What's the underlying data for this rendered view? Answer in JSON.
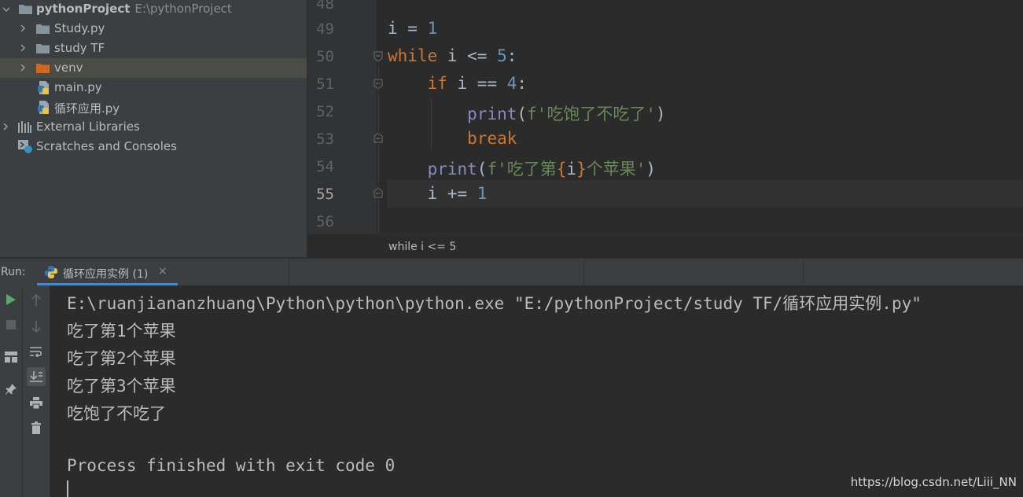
{
  "project": {
    "root_name": "pythonProject",
    "root_path": "E:\\pythonProject",
    "items": [
      {
        "label": "Study.py",
        "type": "folder"
      },
      {
        "label": "study TF",
        "type": "folder"
      },
      {
        "label": "venv",
        "type": "folder-excluded"
      },
      {
        "label": "main.py",
        "type": "python-file"
      },
      {
        "label": "循环应用.py",
        "type": "python-file"
      }
    ],
    "external_libraries": "External Libraries",
    "scratches": "Scratches and Consoles"
  },
  "editor": {
    "line_numbers": [
      "48",
      "49",
      "50",
      "51",
      "52",
      "53",
      "54",
      "55",
      "56"
    ],
    "current_line": "55",
    "code": {
      "l49": {
        "var": "i",
        "op": " = ",
        "num": "1"
      },
      "l50": {
        "kw": "while",
        "mid": " i <= ",
        "num": "5",
        "end": ":"
      },
      "l51": {
        "kw": "if",
        "mid": " i == ",
        "num": "4",
        "end": ":"
      },
      "l52": {
        "fn": "print",
        "open": "(",
        "str": "f'吃饱了不吃了'",
        "close": ")"
      },
      "l53": {
        "kw": "break"
      },
      "l54": {
        "fn": "print",
        "open": "(",
        "str1": "f'吃了第",
        "br1": "{",
        "var": "i",
        "br2": "}",
        "str2": "个苹果'",
        "close": ")"
      },
      "l55": {
        "mid": "i += ",
        "num": "1"
      }
    },
    "breadcrumb": "while i <= 5"
  },
  "run": {
    "label": "Run:",
    "tab_title": "循环应用实例 (1)",
    "tab_close": "×",
    "console_lines": [
      "E:\\ruanjiananzhuang\\Python\\python\\python.exe \"E:/pythonProject/study TF/循环应用实例.py\"",
      "吃了第1个苹果",
      "吃了第2个苹果",
      "吃了第3个苹果",
      "吃饱了不吃了",
      "",
      "Process finished with exit code 0"
    ]
  },
  "watermark": "https://blog.csdn.net/Liii_NN",
  "colors": {
    "keyword": "#cc7832",
    "number": "#6897bb",
    "builtin": "#8888c6",
    "string": "#6a8759",
    "accent": "#4a88c7",
    "run_green": "#59a869"
  }
}
